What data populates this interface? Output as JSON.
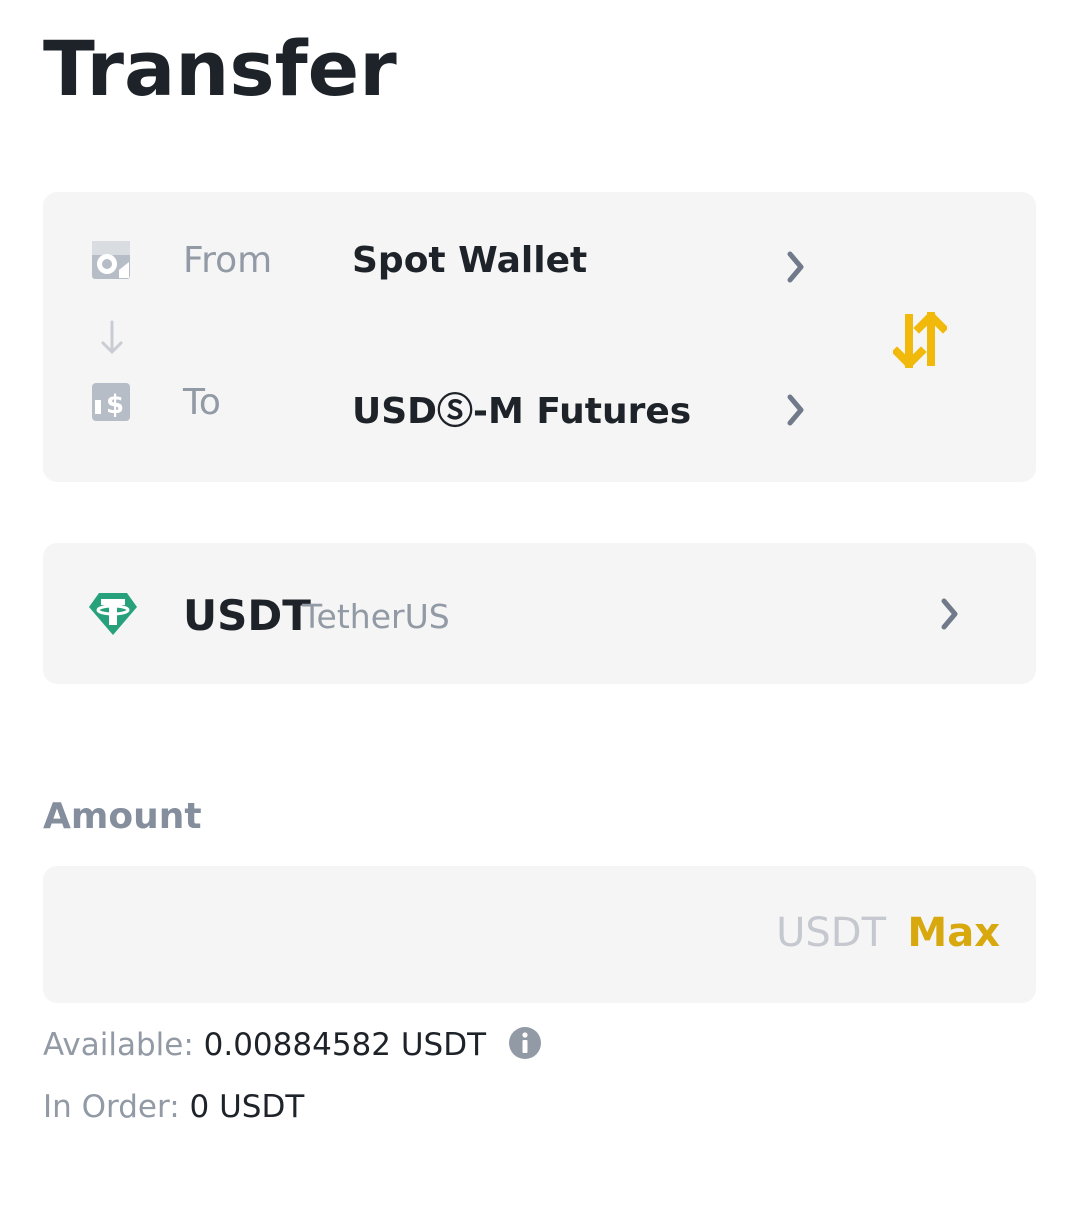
{
  "page": {
    "title": "Transfer"
  },
  "wallet": {
    "from_label": "From",
    "from_value": "Spot Wallet",
    "to_label": "To",
    "to_value": "USDⓈ-M Futures"
  },
  "coin": {
    "symbol": "USDT",
    "name": "TetherUS",
    "icon": "tether-icon",
    "color": "#26a17b"
  },
  "amount": {
    "label": "Amount",
    "value": "",
    "unit": "USDT",
    "max_label": "Max"
  },
  "balances": {
    "available_label": "Available:",
    "available_value": "0.00884582 USDT",
    "in_order_label": "In Order:",
    "in_order_value": "0 USDT"
  },
  "colors": {
    "accent": "#d8a80f",
    "swap": "#f0b90b",
    "card_bg": "#f5f5f5"
  }
}
